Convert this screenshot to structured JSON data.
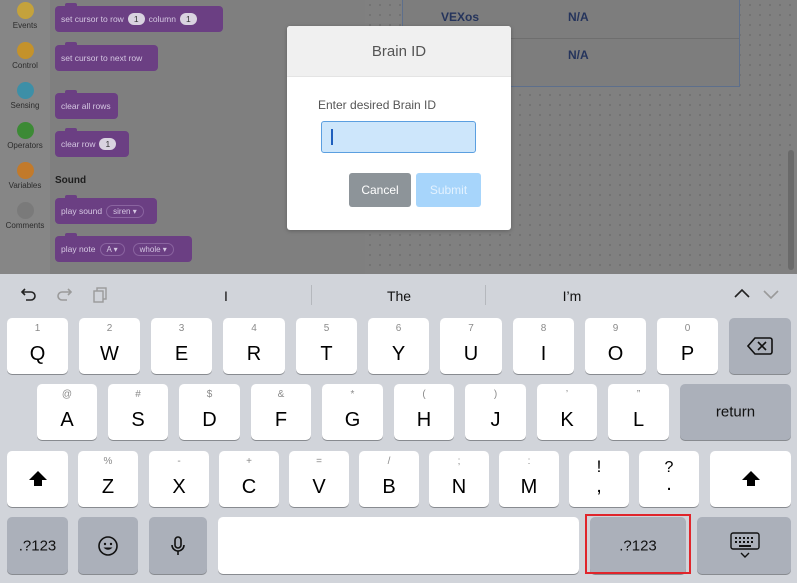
{
  "categories": [
    {
      "label": "Events",
      "color": "#c4a23c"
    },
    {
      "label": "Control",
      "color": "#c4922b"
    },
    {
      "label": "Sensing",
      "color": "#3d8fa7"
    },
    {
      "label": "Operators",
      "color": "#3c8a35"
    },
    {
      "label": "Variables",
      "color": "#c27a2b"
    },
    {
      "label": "Comments",
      "color": "#7a7a7a"
    }
  ],
  "blocks": {
    "set_cursor": {
      "prefix": "set cursor to row",
      "row_value": "1",
      "middle": "column",
      "col_value": "1"
    },
    "next_row": "set cursor to next row",
    "clear_all": "clear all rows",
    "clear_row": {
      "label": "clear row",
      "value": "1"
    },
    "sound_section": "Sound",
    "play_sound": {
      "label": "play sound",
      "option": "siren"
    },
    "play_note": {
      "label": "play note",
      "note": "A",
      "duration": "whole"
    }
  },
  "info_table": [
    {
      "key": "VEXos",
      "value": "N/A"
    },
    {
      "key": "",
      "value": "N/A"
    }
  ],
  "dialog": {
    "title": "Brain ID",
    "label": "Enter desired Brain ID",
    "input_value": "",
    "cancel": "Cancel",
    "submit": "Submit"
  },
  "keyboard": {
    "suggestions": [
      "I",
      "The",
      "I’m"
    ],
    "icons": {
      "undo": "undo-icon",
      "redo": "redo-icon",
      "paste": "paste-icon",
      "up": "chevron-up-icon",
      "down": "chevron-down-icon"
    },
    "row1": [
      {
        "main": "Q",
        "hint": "1"
      },
      {
        "main": "W",
        "hint": "2"
      },
      {
        "main": "E",
        "hint": "3"
      },
      {
        "main": "R",
        "hint": "4"
      },
      {
        "main": "T",
        "hint": "5"
      },
      {
        "main": "Y",
        "hint": "6"
      },
      {
        "main": "U",
        "hint": "7"
      },
      {
        "main": "I",
        "hint": "8"
      },
      {
        "main": "O",
        "hint": "9"
      },
      {
        "main": "P",
        "hint": "0"
      }
    ],
    "row2": [
      {
        "main": "A",
        "hint": "@"
      },
      {
        "main": "S",
        "hint": "#"
      },
      {
        "main": "D",
        "hint": "$"
      },
      {
        "main": "F",
        "hint": "&"
      },
      {
        "main": "G",
        "hint": "*"
      },
      {
        "main": "H",
        "hint": "("
      },
      {
        "main": "J",
        "hint": ")"
      },
      {
        "main": "K",
        "hint": "’"
      },
      {
        "main": "L",
        "hint": "”"
      }
    ],
    "row3": [
      {
        "main": "Z",
        "hint": "%"
      },
      {
        "main": "X",
        "hint": "-"
      },
      {
        "main": "C",
        "hint": "+"
      },
      {
        "main": "V",
        "hint": "="
      },
      {
        "main": "B",
        "hint": "/"
      },
      {
        "main": "N",
        "hint": ";"
      },
      {
        "main": "M",
        "hint": ":"
      },
      {
        "main": ",",
        "hint": "!"
      },
      {
        "main": ".",
        "hint": "?"
      }
    ],
    "return": "return",
    "numbers_left": ".?123",
    "numbers_right": ".?123",
    "highlight_color": "#e0252b"
  }
}
